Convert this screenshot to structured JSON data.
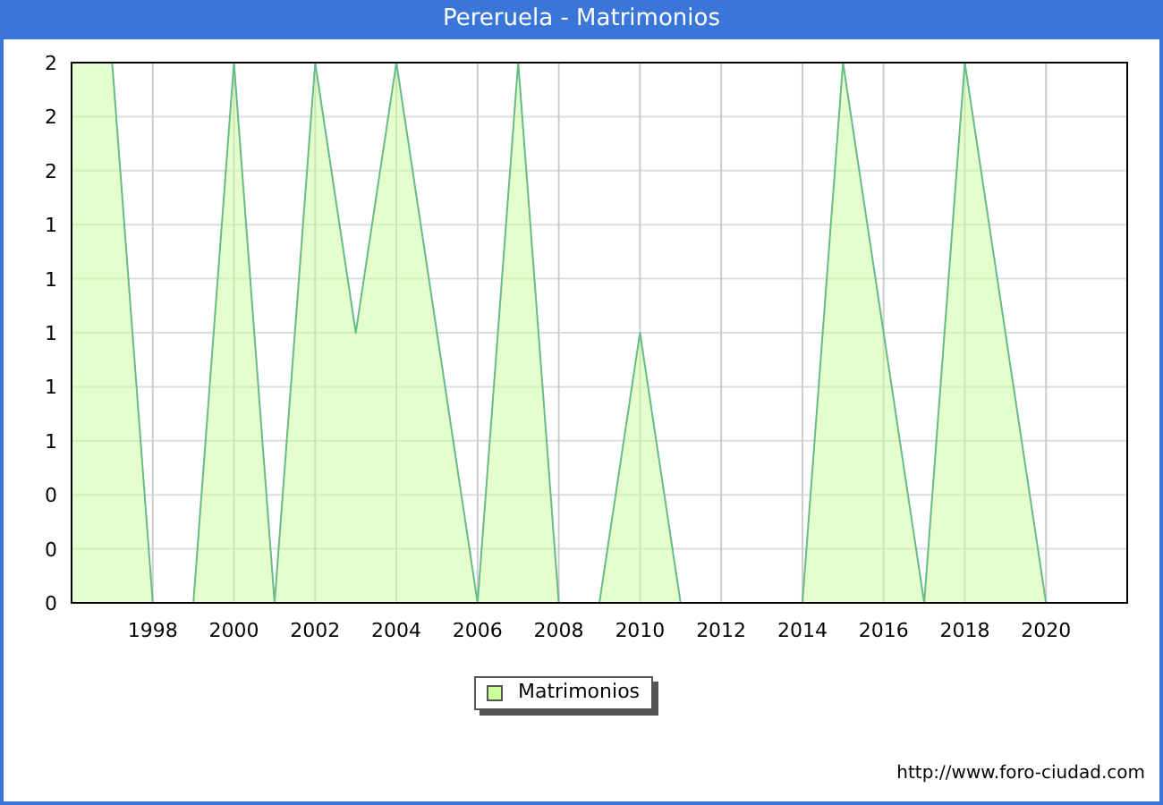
{
  "window": {
    "title": "Pereruela - Matrimonios"
  },
  "chart": {
    "chart_data": {
      "type": "area",
      "grid": true,
      "xlim": [
        1996,
        2022
      ],
      "ylim": [
        0,
        2
      ],
      "x": [
        1996,
        1997,
        1998,
        1999,
        2000,
        2001,
        2002,
        2003,
        2004,
        2005,
        2006,
        2007,
        2008,
        2009,
        2010,
        2011,
        2012,
        2013,
        2014,
        2015,
        2016,
        2017,
        2018,
        2019,
        2020
      ],
      "series": [
        {
          "name": "Matrimonios",
          "color": "#66bb88",
          "values": [
            2,
            2,
            0,
            0,
            2,
            0,
            2,
            1,
            2,
            1,
            0,
            2,
            0,
            0,
            1,
            0,
            0,
            0,
            0,
            2,
            1,
            0,
            2,
            1,
            0
          ]
        }
      ],
      "xticks": [
        1998,
        2000,
        2002,
        2004,
        2006,
        2008,
        2010,
        2012,
        2014,
        2016,
        2018,
        2020
      ],
      "yticks": [
        {
          "value": 0,
          "label": "0"
        },
        {
          "value": 0.2,
          "label": "0"
        },
        {
          "value": 0.4,
          "label": "0"
        },
        {
          "value": 0.6,
          "label": "1"
        },
        {
          "value": 0.8,
          "label": "1"
        },
        {
          "value": 1,
          "label": "1"
        },
        {
          "value": 1.2,
          "label": "1"
        },
        {
          "value": 1.4,
          "label": "1"
        },
        {
          "value": 1.6,
          "label": "2"
        },
        {
          "value": 1.8,
          "label": "2"
        },
        {
          "value": 2,
          "label": "2"
        }
      ]
    }
  },
  "legend": [
    {
      "color": "#ccff99"
    }
  ],
  "footer": "http://www.foro-ciudad.com"
}
